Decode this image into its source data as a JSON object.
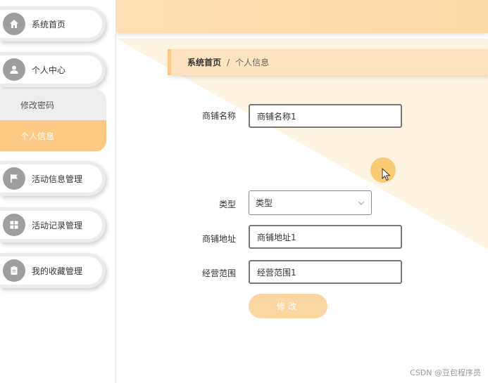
{
  "sidebar": {
    "menu": [
      {
        "label": "系统首页",
        "icon": "home-icon"
      },
      {
        "label": "个人中心",
        "icon": "user-icon"
      },
      {
        "label": "活动信息管理",
        "icon": "flag-icon"
      },
      {
        "label": "活动记录管理",
        "icon": "grid-icon"
      },
      {
        "label": "我的收藏管理",
        "icon": "clipboard-icon"
      }
    ],
    "submenu": [
      {
        "label": "修改密码"
      },
      {
        "label": "个人信息",
        "active": true
      }
    ]
  },
  "breadcrumb": {
    "home": "系统首页",
    "separator": "/",
    "current": "个人信息"
  },
  "form": {
    "shop_name_label": "商铺名称",
    "shop_name_value": "商铺名称1",
    "type_label": "类型",
    "type_value": "类型",
    "address_label": "商铺地址",
    "address_value": "商铺地址1",
    "scope_label": "经营范围",
    "scope_value": "经营范围1",
    "submit_label": "修改"
  },
  "watermark": "CSDN @豆包程序员",
  "colors": {
    "accent": "#fdca85",
    "header": "#fedeb3",
    "breadcrumb_bg": "#fde4bf",
    "button": "#fcd6a0"
  }
}
